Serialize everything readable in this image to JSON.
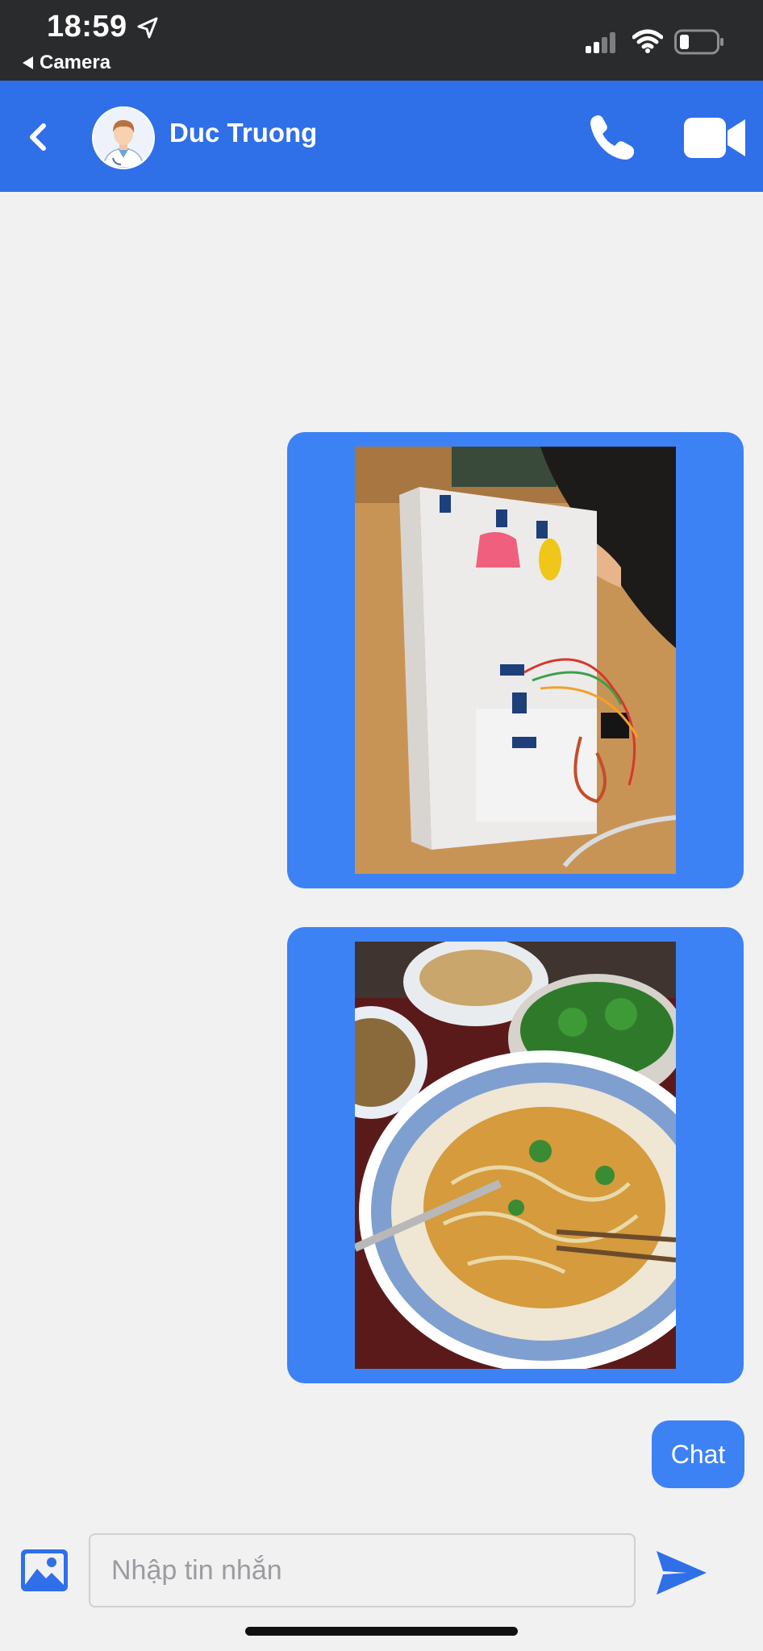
{
  "status_bar": {
    "time": "18:59",
    "back_app_label": "Camera",
    "icons": [
      "location-arrow-icon",
      "cellular-signal-icon",
      "wifi-icon",
      "battery-icon"
    ]
  },
  "header": {
    "contact_name": "Duc Truong",
    "icons": [
      "back-chevron-icon",
      "phone-icon",
      "video-camera-icon"
    ],
    "bg_color": "#2f6fe8"
  },
  "messages": [
    {
      "type": "image",
      "content": "photo of cardboard prototype with sensors, wires and a laptop",
      "sender": "me"
    },
    {
      "type": "image",
      "content": "photo of a bowl of noodles with herbs on a table",
      "sender": "me"
    },
    {
      "type": "text",
      "text": "Chat",
      "sender": "me"
    }
  ],
  "composer": {
    "placeholder": "Nhập tin nhắn",
    "icons": [
      "gallery-icon",
      "send-icon"
    ]
  },
  "colors": {
    "bubble": "#3d82f5",
    "background": "#f1f1f2",
    "status_bar": "#2a2b2d"
  }
}
